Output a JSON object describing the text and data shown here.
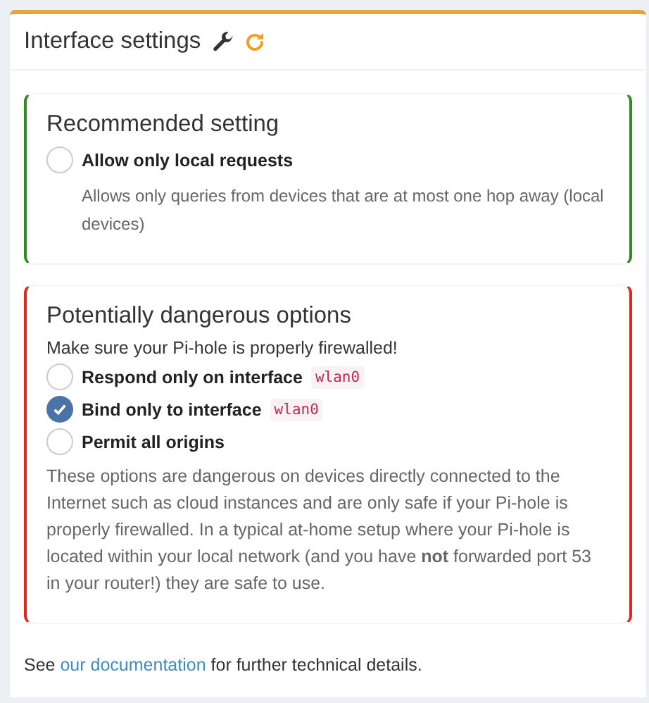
{
  "card": {
    "title": "Interface settings"
  },
  "sections": [
    {
      "kind": "recommended",
      "title": "Recommended setting",
      "options": [
        {
          "label": "Allow only local requests",
          "selected": false,
          "help": "Allows only queries from devices that are at most one hop away (local devices)"
        }
      ]
    },
    {
      "kind": "danger",
      "title": "Potentially dangerous options",
      "note": "Make sure your Pi-hole is properly firewalled!",
      "options": [
        {
          "label": "Respond only on interface",
          "code": "wlan0",
          "selected": false
        },
        {
          "label": "Bind only to interface",
          "code": "wlan0",
          "selected": true
        },
        {
          "label": "Permit all origins",
          "selected": false
        }
      ],
      "description": "These options are dangerous on devices directly connected to the Internet such as cloud instances and are only safe if your Pi-hole is properly firewalled. In a typical at-home setup where your Pi-hole is located within your local network (and you have **not** forwarded port 53 in your router!) they are safe to use."
    }
  ],
  "footer": {
    "before": "See",
    "link": "our documentation",
    "after": "for further technical details."
  }
}
